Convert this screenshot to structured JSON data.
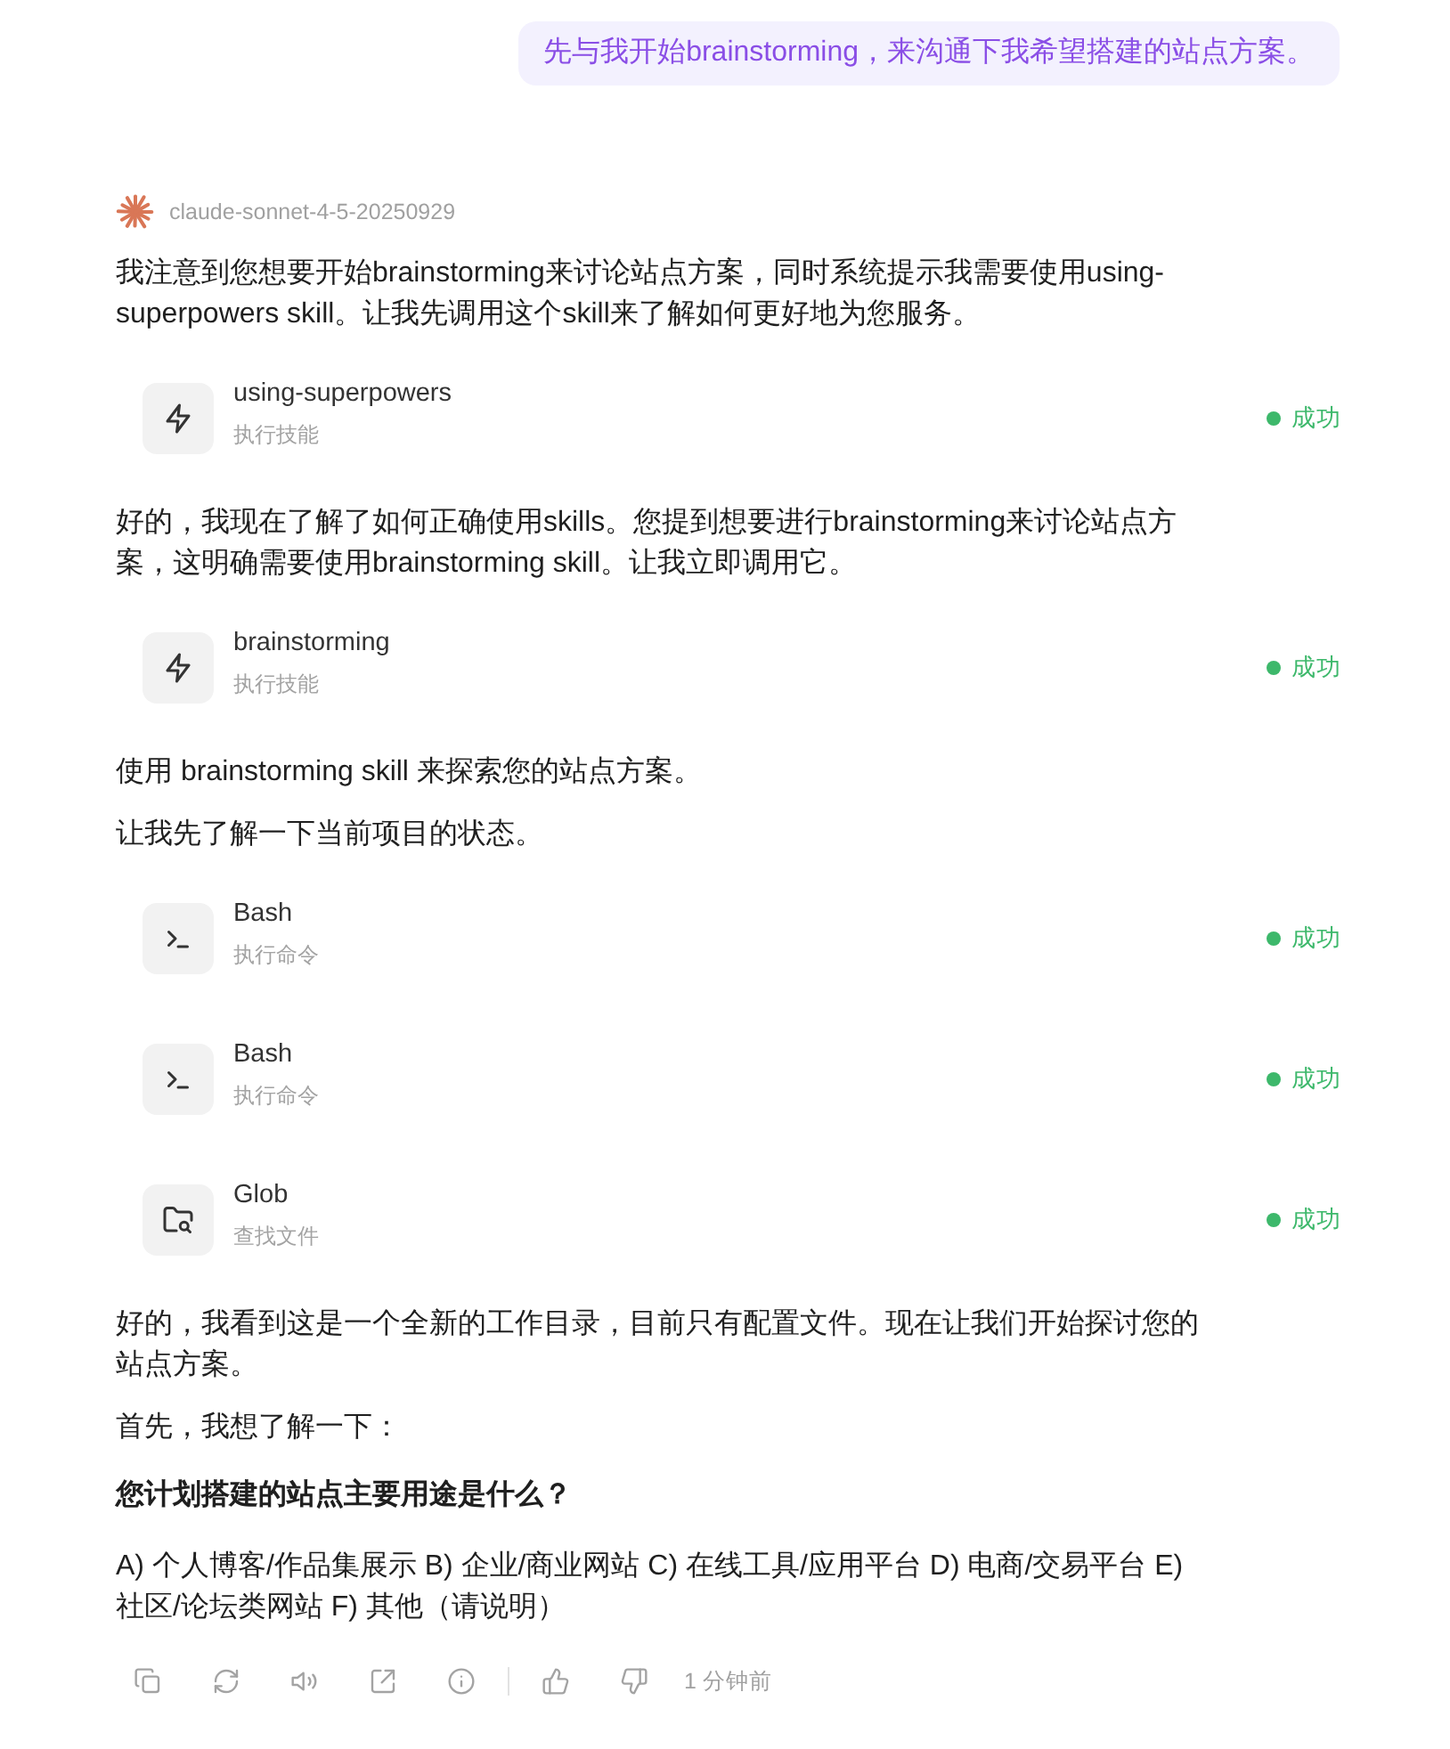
{
  "user_message": {
    "text": "先与我开始brainstorming，来沟通下我希望搭建的站点方案。"
  },
  "assistant": {
    "model": "claude-sonnet-4-5-20250929",
    "blocks": [
      {
        "kind": "paragraph",
        "text": "我注意到您想要开始brainstorming来讨论站点方案，同时系统提示我需要使用using-superpowers skill。让我先调用这个skill来了解如何更好地为您服务。"
      },
      {
        "kind": "skill_call",
        "name": "using-superpowers",
        "action": "执行技能",
        "status": "成功"
      },
      {
        "kind": "paragraph",
        "text": "好的，我现在了解了如何正确使用skills。您提到想要进行brainstorming来讨论站点方案，这明确需要使用brainstorming skill。让我立即调用它。"
      },
      {
        "kind": "skill_call",
        "name": "brainstorming",
        "action": "执行技能",
        "status": "成功"
      },
      {
        "kind": "paragraph",
        "text": "使用 brainstorming skill 来探索您的站点方案。"
      },
      {
        "kind": "paragraph",
        "text": "让我先了解一下当前项目的状态。"
      },
      {
        "kind": "command_call",
        "name": "Bash",
        "action": "执行命令",
        "status": "成功"
      },
      {
        "kind": "command_call",
        "name": "Bash",
        "action": "执行命令",
        "status": "成功"
      },
      {
        "kind": "file_search_call",
        "name": "Glob",
        "action": "查找文件",
        "status": "成功"
      },
      {
        "kind": "paragraph",
        "text": "好的，我看到这是一个全新的工作目录，目前只有配置文件。现在让我们开始探讨您的站点方案。"
      },
      {
        "kind": "paragraph",
        "text": "首先，我想了解一下："
      },
      {
        "kind": "question",
        "text": "您计划搭建的站点主要用途是什么？"
      },
      {
        "kind": "paragraph",
        "text": "A) 个人博客/作品集展示 B) 企业/商业网站 C) 在线工具/应用平台 D) 电商/交易平台 E) 社区/论坛类网站 F) 其他（请说明）"
      }
    ],
    "footer": {
      "time": "1 分钟前"
    }
  }
}
